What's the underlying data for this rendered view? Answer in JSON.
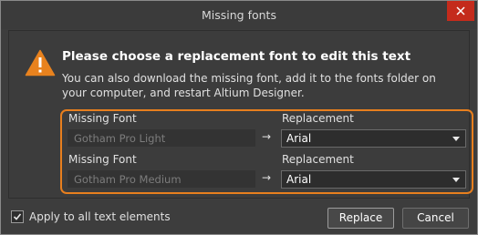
{
  "window": {
    "title": "Missing fonts"
  },
  "message": {
    "heading": "Please choose a replacement font to edit this text",
    "description": "You can also download the missing font, add it to the fonts folder on your computer, and restart Altium Designer."
  },
  "fonts": [
    {
      "missing_label": "Missing Font",
      "missing_value": "Gotham Pro Light",
      "replacement_label": "Replacement",
      "replacement_value": "Arial"
    },
    {
      "missing_label": "Missing Font",
      "missing_value": "Gotham Pro Medium",
      "replacement_label": "Replacement",
      "replacement_value": "Arial"
    }
  ],
  "arrow_glyph": "→",
  "footer": {
    "apply_all_label": "Apply to all text elements",
    "apply_all_checked": true,
    "replace_label": "Replace",
    "cancel_label": "Cancel"
  },
  "colors": {
    "highlight_border": "#e87f1e",
    "warning_icon": "#e8821e",
    "close_button": "#c42b1c"
  },
  "icons": {
    "warning": "warning-triangle-icon",
    "close": "close-icon",
    "checkmark": "checkmark-icon",
    "dropdown": "chevron-down-icon"
  }
}
